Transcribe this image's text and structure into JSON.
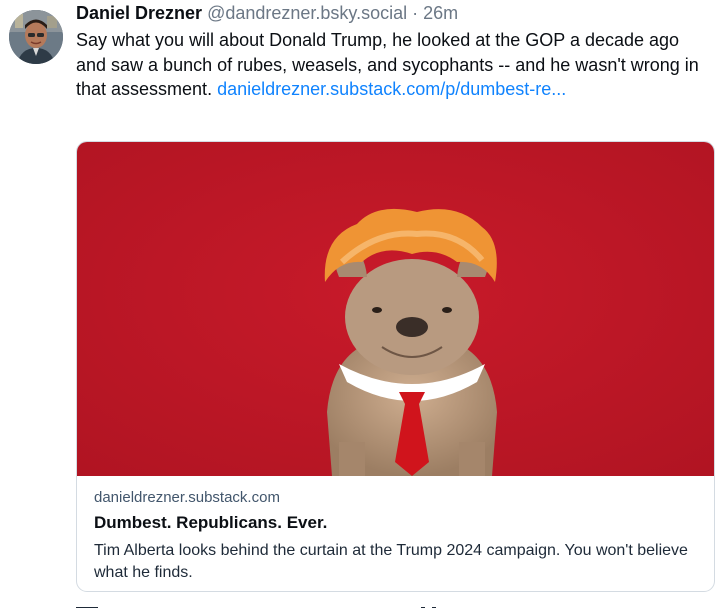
{
  "post": {
    "author_name": "Daniel Drezner",
    "author_handle": "@dandrezner.bsky.social",
    "separator": "·",
    "timestamp": "26m",
    "text": "Say what you will about Donald Trump, he looked at the GOP a decade ago and saw a bunch of rubes, weasels, and sycophants -- and he wasn't wrong in that assessment.",
    "link_text": "danieldrezner.substack.com/p/dumbest-re..."
  },
  "link_card": {
    "domain": "danieldrezner.substack.com",
    "title": "Dumbest. Republicans. Ever.",
    "description": "Tim Alberta looks behind the curtain at the Trump 2024 campaign. You won't believe what he finds."
  },
  "colors": {
    "link": "#1083fe",
    "image_background": "#c21727",
    "wig": "#f0963a",
    "tie": "#d0141c"
  },
  "icons": {
    "avatar": "author-avatar-photo"
  }
}
